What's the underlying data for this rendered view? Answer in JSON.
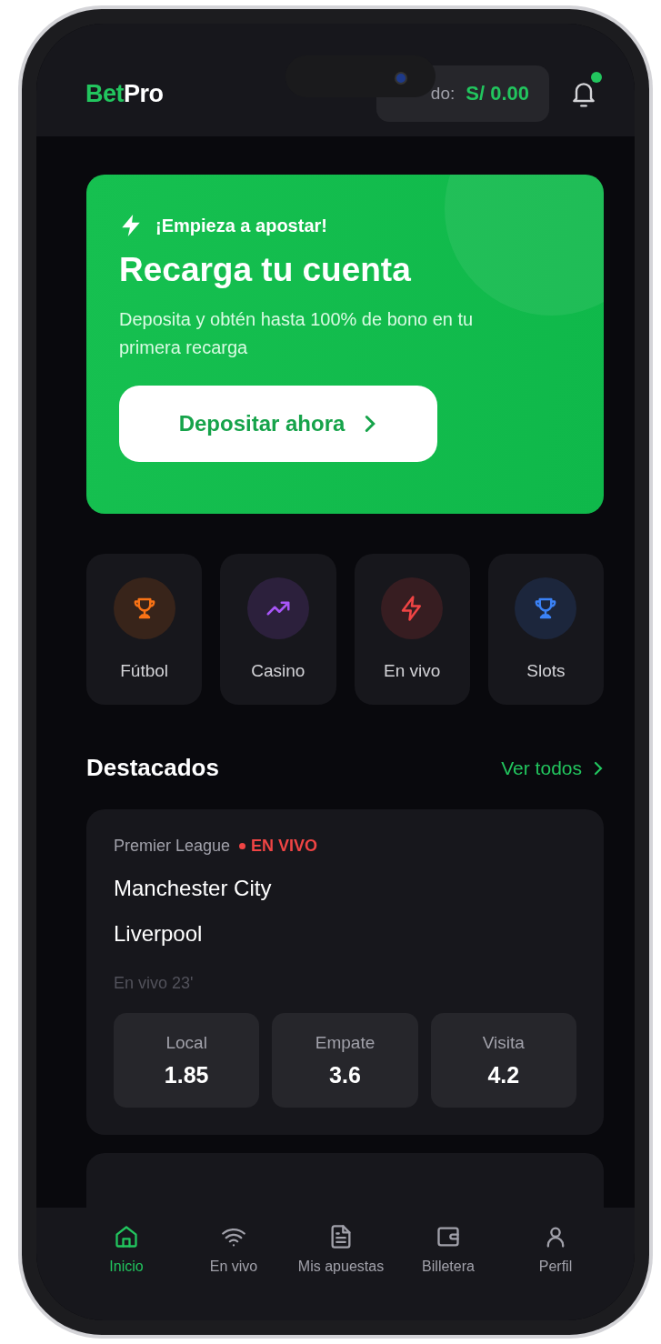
{
  "header": {
    "logo_part_1": "Bet",
    "logo_part_2": "Pro",
    "balance_label": "do:",
    "balance_value": "S/ 0.00",
    "has_notification": true
  },
  "banner": {
    "eyebrow": "¡Empieza a apostar!",
    "title": "Recarga tu cuenta",
    "description": "Deposita y obtén hasta 100% de bono en tu primera recarga",
    "button": "Depositar ahora"
  },
  "categories": [
    {
      "label": "Fútbol",
      "kind": "trophy",
      "color": "#f97316"
    },
    {
      "label": "Casino",
      "kind": "trend",
      "color": "#a855f7"
    },
    {
      "label": "En vivo",
      "kind": "bolt",
      "color": "#ef4444"
    },
    {
      "label": "Slots",
      "kind": "trophy",
      "color": "#3b82f6"
    }
  ],
  "featured": {
    "title": "Destacados",
    "link": "Ver todos"
  },
  "matches": [
    {
      "league": "Premier League",
      "live_badge": "EN VIVO",
      "home": "Manchester City",
      "away": "Liverpool",
      "status": "En vivo 23'",
      "odds": [
        {
          "label": "Local",
          "value": "1.85"
        },
        {
          "label": "Empate",
          "value": "3.6"
        },
        {
          "label": "Visita",
          "value": "4.2"
        }
      ]
    }
  ],
  "nav": [
    {
      "label": "Inicio",
      "kind": "home",
      "selected": true
    },
    {
      "label": "En vivo",
      "kind": "wifi",
      "selected": false
    },
    {
      "label": "Mis apuestas",
      "kind": "doc",
      "selected": false
    },
    {
      "label": "Billetera",
      "kind": "wallet",
      "selected": false
    },
    {
      "label": "Perfil",
      "kind": "user",
      "selected": false
    }
  ]
}
